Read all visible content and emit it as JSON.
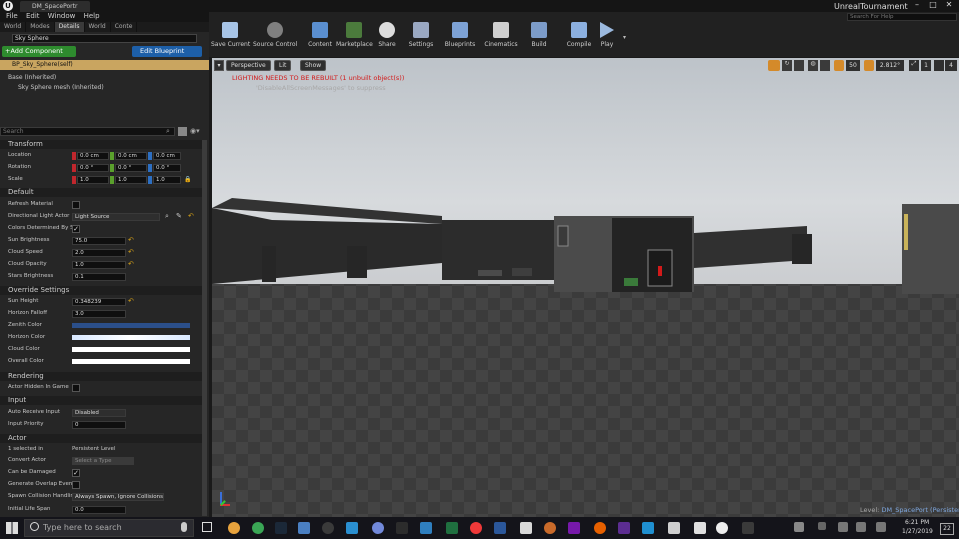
{
  "window": {
    "doc_tab": "DM_SpacePortr",
    "project": "UnrealTournament",
    "search_placeholder": "Search For Help"
  },
  "menu": [
    "File",
    "Edit",
    "Window",
    "Help"
  ],
  "panel_tabs": [
    "World",
    "Modes",
    "Details",
    "World",
    "Conte"
  ],
  "details": {
    "name_value": "Sky Sphere",
    "add_component": "+Add Component",
    "edit_blueprint": "Edit Blueprint",
    "self_item": "BP_Sky_Sphere(self)",
    "tree": [
      "Base (Inherited)",
      "Sky Sphere mesh (Inherited)"
    ],
    "search_placeholder": "Search"
  },
  "sections": {
    "transform": "Transform",
    "default": "Default",
    "override": "Override Settings",
    "rendering": "Rendering",
    "input": "Input",
    "actor": "Actor"
  },
  "transform": {
    "location_label": "Location",
    "rotation_label": "Rotation",
    "scale_label": "Scale",
    "location": [
      "0.0 cm",
      "0.0 cm",
      "0.0 cm"
    ],
    "rotation": [
      "0.0 °",
      "0.0 °",
      "0.0 °"
    ],
    "scale": [
      "1.0",
      "1.0",
      "1.0"
    ]
  },
  "default_props": {
    "refresh_label": "Refresh Material",
    "dir_light_label": "Directional Light Actor",
    "dir_light_value": "Light Source",
    "colors_label": "Colors Determined By S",
    "sun_brightness_label": "Sun Brightness",
    "sun_brightness": "75.0",
    "cloud_speed_label": "Cloud Speed",
    "cloud_speed": "2.0",
    "cloud_opacity_label": "Cloud Opacity",
    "cloud_opacity": "1.0",
    "stars_label": "Stars Brightness",
    "stars": "0.1"
  },
  "override_props": {
    "sun_height_label": "Sun Height",
    "sun_height": "0.348239",
    "horizon_falloff_label": "Horizon Falloff",
    "horizon_falloff": "3.0",
    "zenith_label": "Zenith Color",
    "horizon_color_label": "Horizon Color",
    "cloud_color_label": "Cloud Color",
    "overall_label": "Overall Color"
  },
  "rendering": {
    "hidden_label": "Actor Hidden In Game"
  },
  "input": {
    "auto_receive_label": "Auto Receive Input",
    "auto_receive": "Disabled",
    "priority_label": "Input Priority",
    "priority": "0"
  },
  "actor": {
    "selected_label": "1 selected in",
    "selected_value": "Persistent Level",
    "convert_label": "Convert Actor",
    "convert_value": "Select a Type",
    "damaged_label": "Can be Damaged",
    "overlap_label": "Generate Overlap Events",
    "spawn_label": "Spawn Collision Handling",
    "spawn_value": "Always Spawn, Ignore Collisions",
    "lifespan_label": "Initial Life Span",
    "lifespan": "0.0"
  },
  "toolbar": [
    "Save Current",
    "Source Control",
    "Content",
    "Marketplace",
    "Share",
    "Settings",
    "Blueprints",
    "Cinematics",
    "Build",
    "Compile",
    "Play"
  ],
  "viewport": {
    "perspective": "Perspective",
    "lit": "Lit",
    "show": "Show",
    "warning": "LIGHTING NEEDS TO BE REBUILT (1 unbuilt object(s))",
    "suppress": "'DisableAllScreenMessages' to suppress",
    "grid_value": "50",
    "angle": "2.812°",
    "scale": "1",
    "cam_speed": "4",
    "level_label": "Level:",
    "level_name": "DM_SpacePort (Persistent)"
  },
  "taskbar": {
    "search_placeholder": "Type here to search",
    "time": "6:21 PM",
    "date": "1/27/2019",
    "notif": "22"
  },
  "colors": {
    "zenith": "#2b4f8a",
    "horizon": "#e8f2ff",
    "cloud": "#ffffff",
    "overall": "#ffffff",
    "add_btn": "#2e8b2e",
    "blueprint_btn": "#1d5fa8",
    "warning": "#d21a1a"
  }
}
